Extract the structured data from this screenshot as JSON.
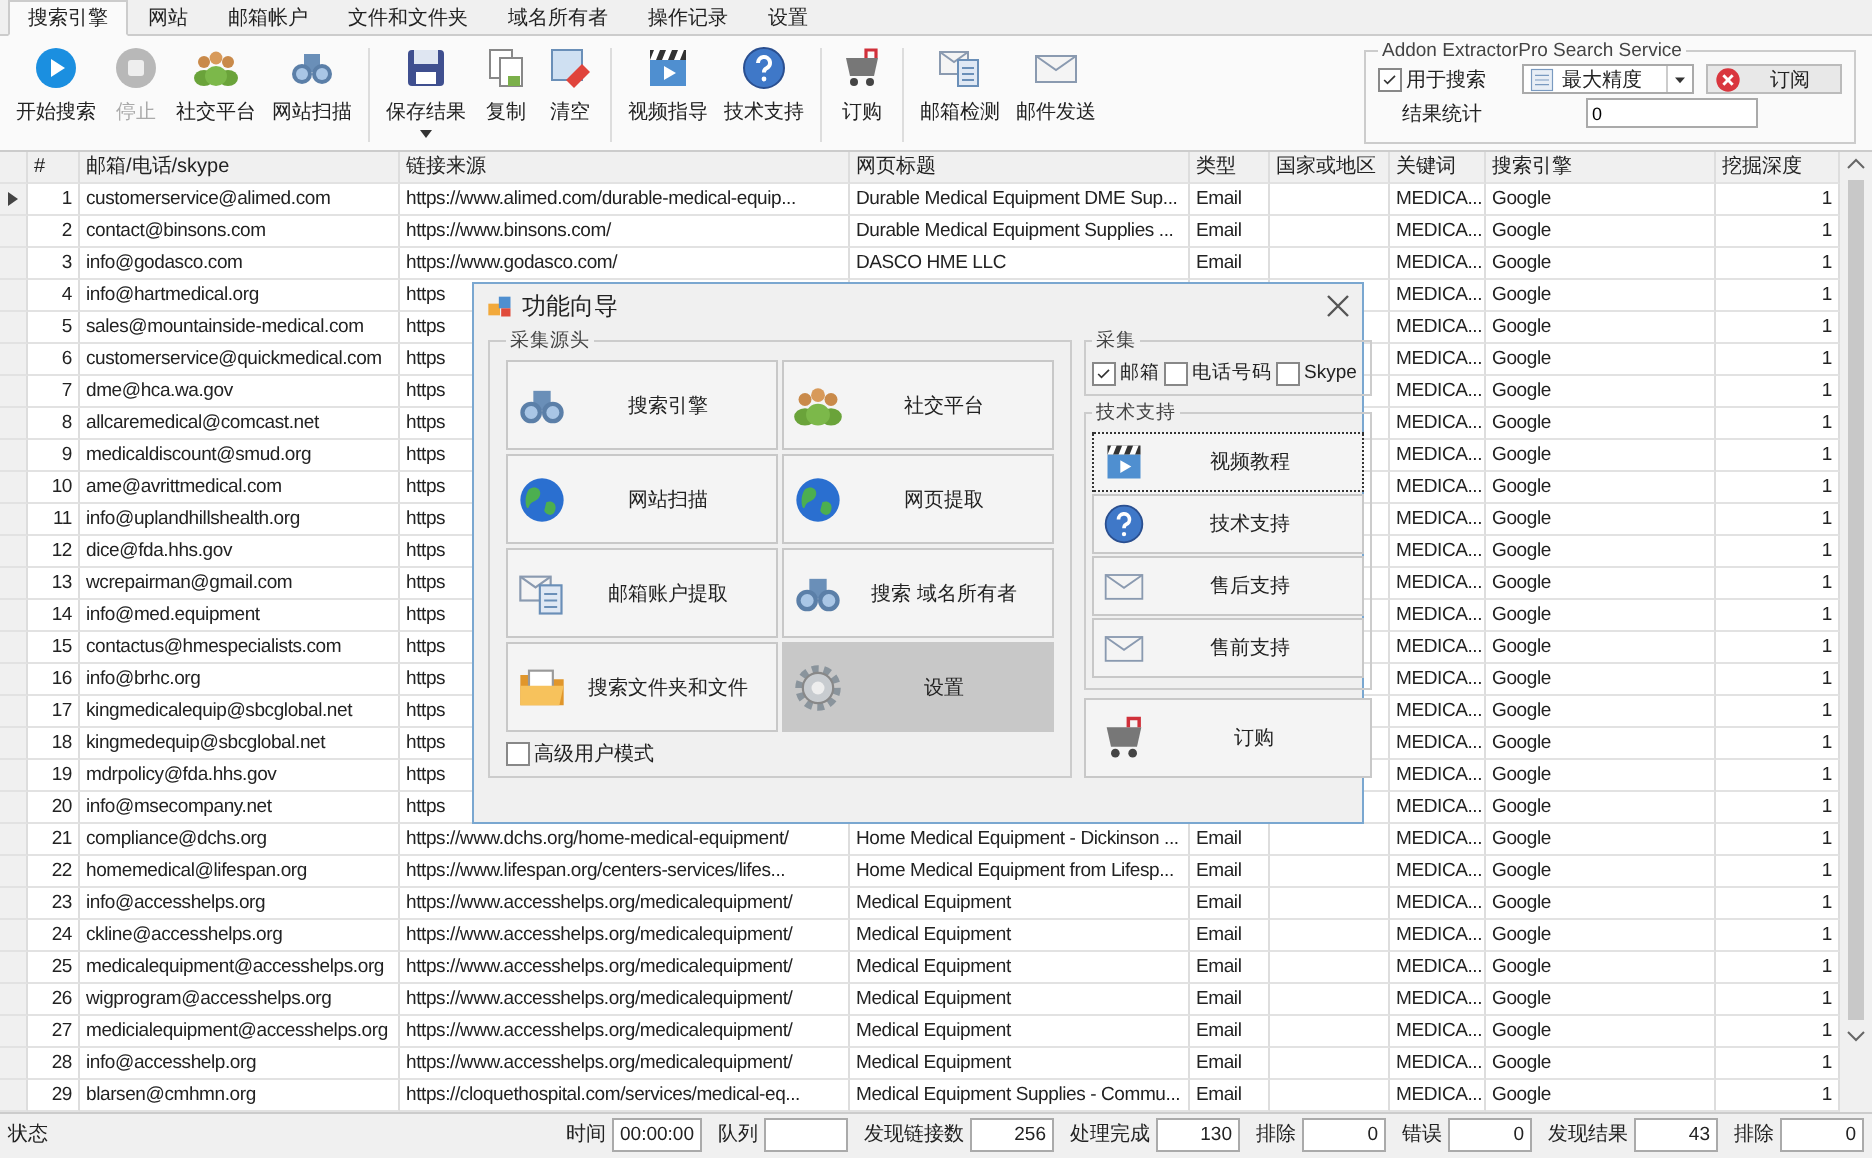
{
  "tabs": [
    {
      "label": "搜索引擎",
      "selected": true
    },
    {
      "label": "网站",
      "selected": false
    },
    {
      "label": "邮箱帐户",
      "selected": false
    },
    {
      "label": "文件和文件夹",
      "selected": false
    },
    {
      "label": "域名所有者",
      "selected": false
    },
    {
      "label": "操作记录",
      "selected": false
    },
    {
      "label": "设置",
      "selected": false
    }
  ],
  "toolbar_groups": [
    [
      {
        "label": "开始搜索",
        "kind": "play",
        "disabled": false,
        "dropdown": false
      },
      {
        "label": "停止",
        "kind": "stop",
        "disabled": true,
        "dropdown": false
      },
      {
        "label": "社交平台",
        "kind": "people",
        "disabled": false,
        "dropdown": false
      },
      {
        "label": "网站扫描",
        "kind": "binoculars",
        "disabled": false,
        "dropdown": false
      }
    ],
    [
      {
        "label": "保存结果",
        "kind": "save",
        "disabled": false,
        "dropdown": true
      },
      {
        "label": "复制",
        "kind": "copy",
        "disabled": false,
        "dropdown": false
      },
      {
        "label": "清空",
        "kind": "clear",
        "disabled": false,
        "dropdown": false
      }
    ],
    [
      {
        "label": "视频指导",
        "kind": "video",
        "disabled": false,
        "dropdown": false
      },
      {
        "label": "技术支持",
        "kind": "help",
        "disabled": false,
        "dropdown": false
      }
    ],
    [
      {
        "label": "订购",
        "kind": "cart",
        "disabled": false,
        "dropdown": false
      }
    ],
    [
      {
        "label": "邮箱检测",
        "kind": "mailcheck",
        "disabled": false,
        "dropdown": false
      },
      {
        "label": "邮件发送",
        "kind": "mail",
        "disabled": false,
        "dropdown": false
      }
    ]
  ],
  "search_service": {
    "title": "Addon ExtractorPro Search Service",
    "use_for_search": {
      "label": "用于搜索",
      "checked": true
    },
    "precision": "最大精度",
    "subscribe": "订阅",
    "result_stats": {
      "label": "结果统计",
      "value": "0"
    }
  },
  "table": {
    "columns": [
      "#",
      "邮箱/电话/skype",
      "链接来源",
      "网页标题",
      "类型",
      "国家或地区",
      "关键词",
      "搜索引擎",
      "挖掘深度"
    ],
    "rows": [
      {
        "num": "1",
        "email": "customerservice@alimed.com",
        "link": "https://www.alimed.com/durable-medical-equip...",
        "title": "Durable Medical Equipment  DME Sup...",
        "type": "Email",
        "keyword": "MEDICA...",
        "engine": "Google",
        "depth": "1",
        "selected": true
      },
      {
        "num": "2",
        "email": "contact@binsons.com",
        "link": "https://www.binsons.com/",
        "title": "Durable Medical Equipment Supplies  ...",
        "type": "Email",
        "keyword": "MEDICA...",
        "engine": "Google",
        "depth": "1",
        "selected": false
      },
      {
        "num": "3",
        "email": "info@godasco.com",
        "link": "https://www.godasco.com/",
        "title": "DASCO HME LLC",
        "type": "Email",
        "keyword": "MEDICA...",
        "engine": "Google",
        "depth": "1",
        "selected": false
      },
      {
        "num": "4",
        "email": "info@hartmedical.org",
        "link": "https",
        "keyword": "MEDICA...",
        "engine": "Google",
        "depth": "1",
        "selected": false
      },
      {
        "num": "5",
        "email": "sales@mountainside-medical.com",
        "link": "https",
        "keyword": "MEDICA...",
        "engine": "Google",
        "depth": "1",
        "selected": false
      },
      {
        "num": "6",
        "email": "customerservice@quickmedical.com",
        "link": "https",
        "keyword": "MEDICA...",
        "engine": "Google",
        "depth": "1",
        "selected": false
      },
      {
        "num": "7",
        "email": "dme@hca.wa.gov",
        "link": "https",
        "keyword": "MEDICA...",
        "engine": "Google",
        "depth": "1",
        "selected": false
      },
      {
        "num": "8",
        "email": "allcaremedical@comcast.net",
        "link": "https",
        "keyword": "MEDICA...",
        "engine": "Google",
        "depth": "1",
        "selected": false
      },
      {
        "num": "9",
        "email": "medicaldiscount@smud.org",
        "link": "https",
        "keyword": "MEDICA...",
        "engine": "Google",
        "depth": "1",
        "selected": false
      },
      {
        "num": "10",
        "email": "ame@avrittmedical.com",
        "link": "https",
        "keyword": "MEDICA...",
        "engine": "Google",
        "depth": "1",
        "selected": false
      },
      {
        "num": "11",
        "email": "info@uplandhillshealth.org",
        "link": "https",
        "keyword": "MEDICA...",
        "engine": "Google",
        "depth": "1",
        "selected": false
      },
      {
        "num": "12",
        "email": "dice@fda.hhs.gov",
        "link": "https",
        "keyword": "MEDICA...",
        "engine": "Google",
        "depth": "1",
        "selected": false
      },
      {
        "num": "13",
        "email": "wcrepairman@gmail.com",
        "link": "https",
        "keyword": "MEDICA...",
        "engine": "Google",
        "depth": "1",
        "selected": false
      },
      {
        "num": "14",
        "email": "info@med.equipment",
        "link": "https",
        "keyword": "MEDICA...",
        "engine": "Google",
        "depth": "1",
        "selected": false
      },
      {
        "num": "15",
        "email": "contactus@hmespecialists.com",
        "link": "https",
        "keyword": "MEDICA...",
        "engine": "Google",
        "depth": "1",
        "selected": false
      },
      {
        "num": "16",
        "email": "info@brhc.org",
        "link": "https",
        "keyword": "MEDICA...",
        "engine": "Google",
        "depth": "1",
        "selected": false
      },
      {
        "num": "17",
        "email": "kingmedicalequip@sbcglobal.net",
        "link": "https",
        "keyword": "MEDICA...",
        "engine": "Google",
        "depth": "1",
        "selected": false
      },
      {
        "num": "18",
        "email": "kingmedequip@sbcglobal.net",
        "link": "https",
        "keyword": "MEDICA...",
        "engine": "Google",
        "depth": "1",
        "selected": false
      },
      {
        "num": "19",
        "email": "mdrpolicy@fda.hhs.gov",
        "link": "https",
        "keyword": "MEDICA...",
        "engine": "Google",
        "depth": "1",
        "selected": false
      },
      {
        "num": "20",
        "email": "info@msecompany.net",
        "link": "https",
        "keyword": "MEDICA...",
        "engine": "Google",
        "depth": "1",
        "selected": false
      },
      {
        "num": "21",
        "email": "compliance@dchs.org",
        "link": "https://www.dchs.org/home-medical-equipment/",
        "title": "Home Medical Equipment - Dickinson ...",
        "type": "Email",
        "keyword": "MEDICA...",
        "engine": "Google",
        "depth": "1",
        "selected": false
      },
      {
        "num": "22",
        "email": "homemedical@lifespan.org",
        "link": "https://www.lifespan.org/centers-services/lifes...",
        "title": "Home Medical Equipment from Lifesp...",
        "type": "Email",
        "keyword": "MEDICA...",
        "engine": "Google",
        "depth": "1",
        "selected": false
      },
      {
        "num": "23",
        "email": "info@accesshelps.org",
        "link": "https://www.accesshelps.org/medicalequipment/",
        "title": "Medical Equipment",
        "type": "Email",
        "keyword": "MEDICA...",
        "engine": "Google",
        "depth": "1",
        "selected": false
      },
      {
        "num": "24",
        "email": "ckline@accesshelps.org",
        "link": "https://www.accesshelps.org/medicalequipment/",
        "title": "Medical Equipment",
        "type": "Email",
        "keyword": "MEDICA...",
        "engine": "Google",
        "depth": "1",
        "selected": false
      },
      {
        "num": "25",
        "email": "medicalequipment@accesshelps.org",
        "link": "https://www.accesshelps.org/medicalequipment/",
        "title": "Medical Equipment",
        "type": "Email",
        "keyword": "MEDICA...",
        "engine": "Google",
        "depth": "1",
        "selected": false
      },
      {
        "num": "26",
        "email": "wigprogram@accesshelps.org",
        "link": "https://www.accesshelps.org/medicalequipment/",
        "title": "Medical Equipment",
        "type": "Email",
        "keyword": "MEDICA...",
        "engine": "Google",
        "depth": "1",
        "selected": false
      },
      {
        "num": "27",
        "email": "medicialequipment@accesshelps.org",
        "link": "https://www.accesshelps.org/medicalequipment/",
        "title": "Medical Equipment",
        "type": "Email",
        "keyword": "MEDICA...",
        "engine": "Google",
        "depth": "1",
        "selected": false
      },
      {
        "num": "28",
        "email": "info@accesshelp.org",
        "link": "https://www.accesshelps.org/medicalequipment/",
        "title": "Medical Equipment",
        "type": "Email",
        "keyword": "MEDICA...",
        "engine": "Google",
        "depth": "1",
        "selected": false
      },
      {
        "num": "29",
        "email": "blarsen@cmhmn.org",
        "link": "https://cloquethospital.com/services/medical-eq...",
        "title": "Medical Equipment  Supplies - Commu...",
        "type": "Email",
        "keyword": "MEDICA...",
        "engine": "Google",
        "depth": "1",
        "selected": false
      }
    ]
  },
  "dialog": {
    "title": "功能向导",
    "sources_title": "采集源头",
    "sources": [
      {
        "label": "搜索引擎",
        "kind": "binoculars",
        "highlighted": false
      },
      {
        "label": "社交平台",
        "kind": "people",
        "highlighted": false
      },
      {
        "label": "网站扫描",
        "kind": "globe",
        "highlighted": false
      },
      {
        "label": "网页提取",
        "kind": "globe",
        "highlighted": false
      },
      {
        "label": "邮箱账户提取",
        "kind": "mailcheck",
        "highlighted": false
      },
      {
        "label": "搜索 域名所有者",
        "kind": "binoculars",
        "highlighted": false
      },
      {
        "label": "搜索文件夹和文件",
        "kind": "folder",
        "highlighted": false
      },
      {
        "label": "设置",
        "kind": "gear",
        "highlighted": true
      }
    ],
    "advanced_mode": {
      "label": "高级用户模式",
      "checked": false
    },
    "collect_title": "采集",
    "collect": [
      {
        "label": "邮箱",
        "checked": true
      },
      {
        "label": "电话号码",
        "checked": false
      },
      {
        "label": "Skype",
        "checked": false
      }
    ],
    "support_title": "技术支持",
    "support": [
      {
        "label": "视频教程",
        "kind": "video",
        "focused": true
      },
      {
        "label": "技术支持",
        "kind": "help",
        "focused": false
      },
      {
        "label": "售后支持",
        "kind": "mail",
        "focused": false
      },
      {
        "label": "售前支持",
        "kind": "mail",
        "focused": false
      }
    ],
    "order": {
      "label": "订购",
      "kind": "cart"
    }
  },
  "status_bar": {
    "label": "状态",
    "fields": [
      {
        "label": "时间",
        "value": "00:00:00"
      },
      {
        "label": "队列"
      },
      {
        "label": "发现链接数",
        "value": "256"
      },
      {
        "label": "处理完成",
        "value": "130"
      },
      {
        "label": "排除",
        "value": "0"
      },
      {
        "label": "错误",
        "value": "0"
      },
      {
        "label": "发现结果",
        "value": "43"
      },
      {
        "label": "排除",
        "value": "0"
      }
    ]
  }
}
